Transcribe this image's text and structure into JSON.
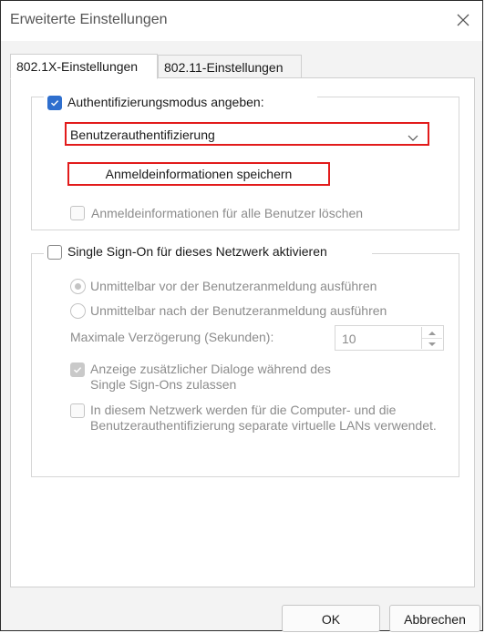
{
  "window": {
    "title": "Erweiterte Einstellungen"
  },
  "tabs": [
    {
      "label": "802.1X-Einstellungen",
      "active": true
    },
    {
      "label": "802.11-Einstellungen",
      "active": false
    }
  ],
  "auth": {
    "checkbox_label": "Authentifizierungsmodus angeben:",
    "checked": true,
    "mode_value": "Benutzerauthentifizierung",
    "save_credentials_label": "Anmeldeinformationen speichern",
    "delete_all_label": "Anmeldeinformationen für alle Benutzer löschen"
  },
  "sso": {
    "checkbox_label": "Single Sign-On für dieses Netzwerk aktivieren",
    "checked": false,
    "radio_before_label": "Unmittelbar vor der Benutzeranmeldung ausführen",
    "radio_after_label": "Unmittelbar nach der Benutzeranmeldung ausführen",
    "delay_label": "Maximale Verzögerung (Sekunden):",
    "delay_value": "10",
    "dialogs_label": "Anzeige zusätzlicher Dialoge während des Single Sign-Ons zulassen",
    "vlan_label": "In diesem Netzwerk werden für die Computer- und die Benutzerauthentifizierung separate virtuelle LANs verwendet."
  },
  "buttons": {
    "ok": "OK",
    "cancel": "Abbrechen"
  },
  "colors": {
    "accent": "#2f6fce",
    "highlight": "#e21b1b",
    "disabled": "#8c8c8c"
  }
}
